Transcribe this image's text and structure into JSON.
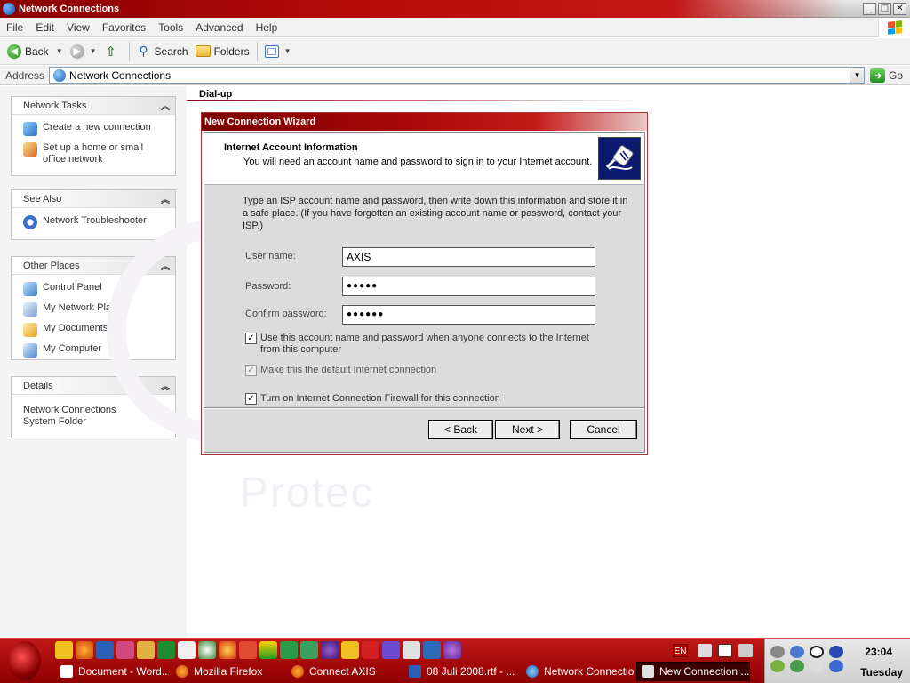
{
  "window": {
    "title": "Network Connections"
  },
  "menu": [
    "File",
    "Edit",
    "View",
    "Favorites",
    "Tools",
    "Advanced",
    "Help"
  ],
  "toolbar": {
    "back": "Back",
    "search": "Search",
    "folders": "Folders"
  },
  "address": {
    "label": "Address",
    "value": "Network Connections",
    "go": "Go"
  },
  "taskpane": {
    "network_tasks": {
      "title": "Network Tasks",
      "items": [
        "Create a new connection",
        "Set up a home or small office network"
      ]
    },
    "see_also": {
      "title": "See Also",
      "items": [
        "Network Troubleshooter"
      ]
    },
    "other_places": {
      "title": "Other Places",
      "items": [
        "Control Panel",
        "My Network Places",
        "My Documents",
        "My Computer"
      ]
    },
    "details": {
      "title": "Details",
      "line1": "Network Connections",
      "line2": "System Folder"
    }
  },
  "content": {
    "group_header": "Dial-up",
    "watermark": "Protec"
  },
  "wizard": {
    "title": "New Connection Wizard",
    "header_title": "Internet Account Information",
    "header_subtitle": "You will need an account name and password to sign in to your Internet account.",
    "description": "Type an ISP account name and password, then write down this information and store it in a safe place. (If you have forgotten an existing account name or password, contact your ISP.)",
    "username_label": "User name:",
    "username_value": "AXIS",
    "password_label": "Password:",
    "password_value": "●●●●●",
    "confirm_label": "Confirm password:",
    "confirm_value": "●●●●●●",
    "check_use_account": "Use this account name and password when anyone connects to the Internet from this computer",
    "check_default": "Make this the default Internet connection",
    "check_firewall": "Turn on Internet Connection Firewall for this connection",
    "btn_back": "< Back",
    "btn_next": "Next >",
    "btn_cancel": "Cancel"
  },
  "taskbar": {
    "tasks": [
      "Document - Word...",
      "Mozilla Firefox",
      "Connect AXIS",
      "08 Juli 2008.rtf - ...",
      "Network Connections",
      "New Connection ..."
    ],
    "lang": "EN",
    "time": "23:04",
    "day": "Tuesday"
  },
  "colors": {
    "title_red": "#a80808",
    "taskbar_red": "#b01010"
  }
}
